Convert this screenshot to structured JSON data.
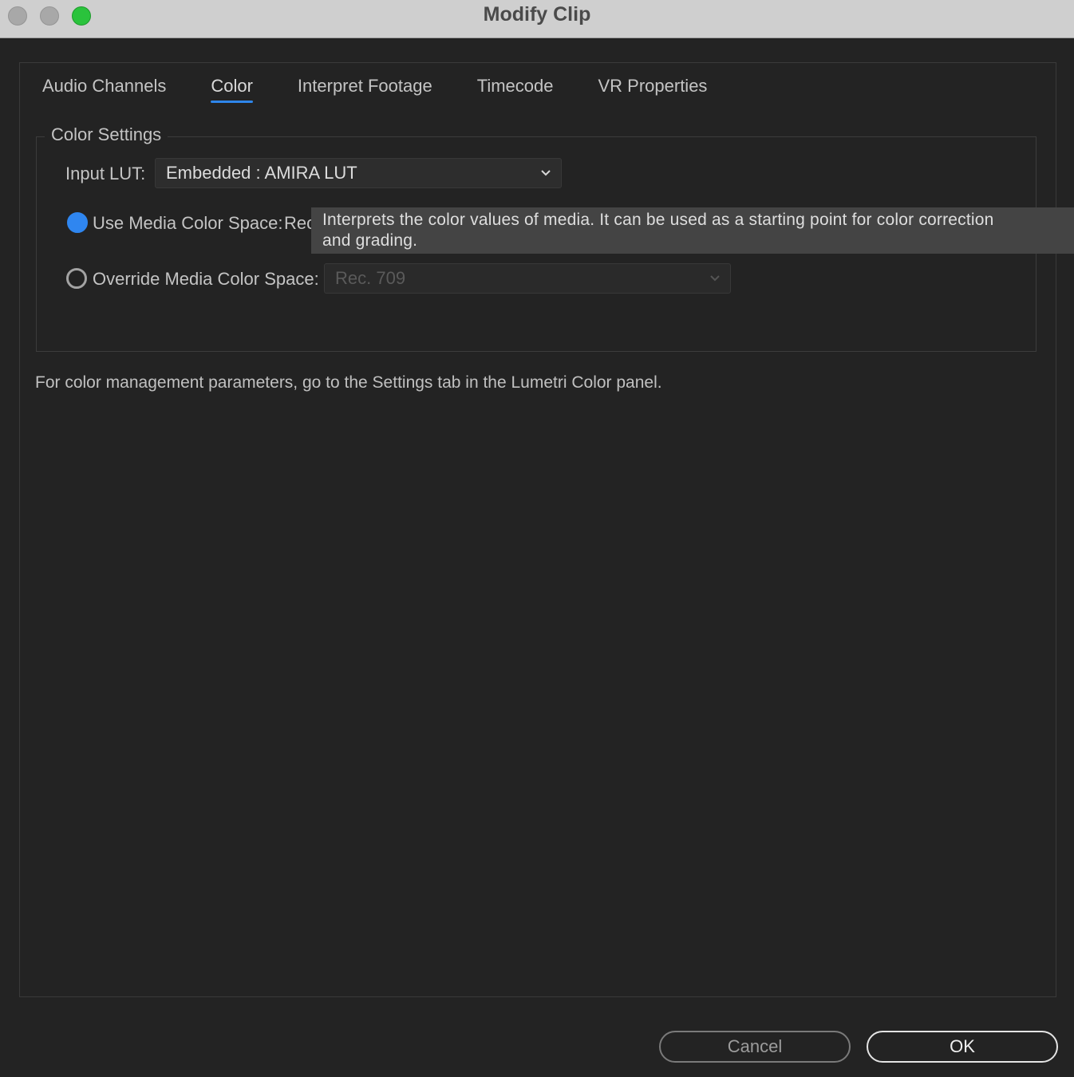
{
  "window": {
    "title": "Modify Clip"
  },
  "tabs": [
    {
      "label": "Audio Channels",
      "active": false
    },
    {
      "label": "Color",
      "active": true
    },
    {
      "label": "Interpret Footage",
      "active": false
    },
    {
      "label": "Timecode",
      "active": false
    },
    {
      "label": "VR Properties",
      "active": false
    }
  ],
  "color_settings": {
    "group_title": "Color Settings",
    "input_lut_label": "Input LUT:",
    "input_lut_value": "Embedded : AMIRA LUT",
    "use_media_label": "Use Media Color Space:",
    "use_media_value": "Rec",
    "use_media_selected": true,
    "override_label": "Override Media Color Space:",
    "override_value": "Rec. 709",
    "override_selected": false
  },
  "tooltip": {
    "line1": "Interprets the color values of media. It can be used as a starting point for color correction",
    "line2": "and grading."
  },
  "note": "For color management parameters, go to the Settings tab in the Lumetri Color panel.",
  "buttons": {
    "cancel": "Cancel",
    "ok": "OK"
  },
  "colors": {
    "accent": "#2f86f0",
    "zoom_button": "#2ac33c",
    "background": "#232323"
  }
}
